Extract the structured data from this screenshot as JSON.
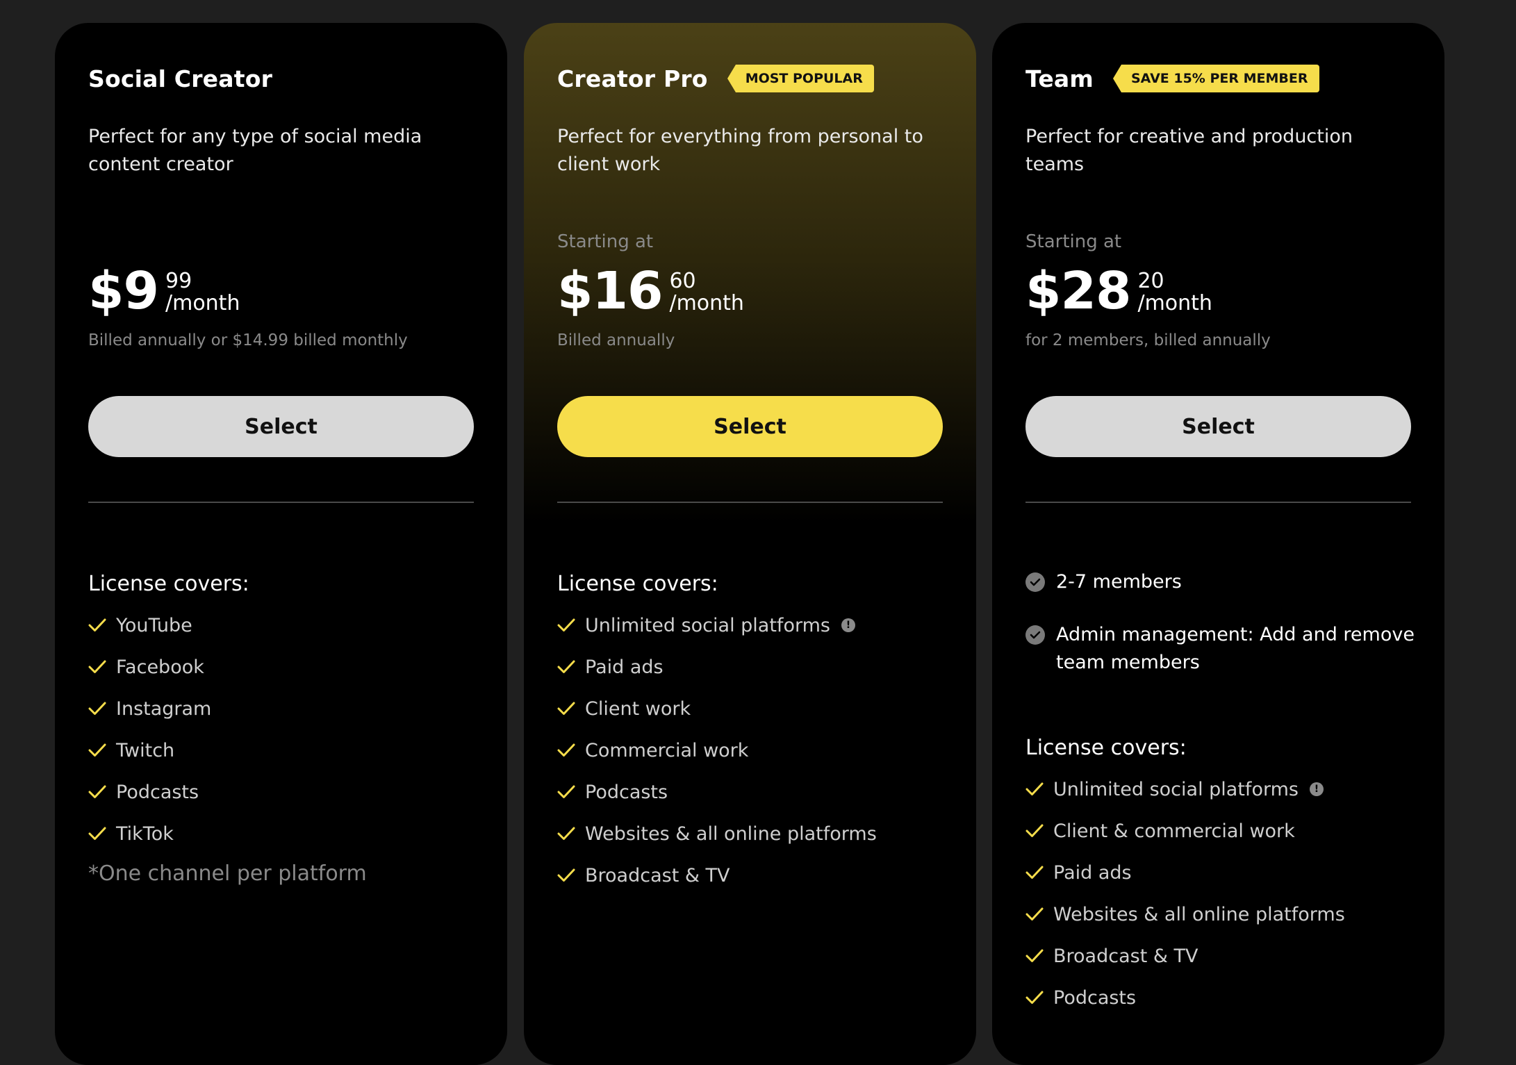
{
  "colors": {
    "accent": "#f6dd4b",
    "background": "#1f1f1f",
    "card": "#000000",
    "button_light": "#d8d8d8"
  },
  "plans": [
    {
      "title": "Social Creator",
      "badge": "",
      "subtitle": "Perfect for any type of social media content creator",
      "starting_label": "",
      "price_whole": "$9",
      "price_cents": "99",
      "price_period": "/month",
      "billing_note": "Billed annually or $14.99 billed monthly",
      "button_label": "Select",
      "license_title": "License covers:",
      "features": [
        "YouTube",
        "Facebook",
        "Instagram",
        "Twitch",
        "Podcasts",
        "TikTok"
      ],
      "footnote": "*One channel per platform"
    },
    {
      "title": "Creator Pro",
      "badge": "MOST POPULAR",
      "subtitle": "Perfect for everything from personal to client work",
      "starting_label": "Starting at",
      "price_whole": "$16",
      "price_cents": "60",
      "price_period": "/month",
      "billing_note": "Billed annually",
      "button_label": "Select",
      "license_title": "License covers:",
      "features": [
        "Unlimited social platforms",
        "Paid ads",
        "Client work",
        "Commercial work",
        "Podcasts",
        "Websites & all online platforms",
        "Broadcast & TV"
      ],
      "info_icon": "!"
    },
    {
      "title": "Team",
      "badge": "SAVE 15% PER MEMBER",
      "subtitle": "Perfect for creative and production teams",
      "starting_label": "Starting at",
      "price_whole": "$28",
      "price_cents": "20",
      "price_period": "/month",
      "billing_note": "for 2 members, billed annually",
      "button_label": "Select",
      "member_features": [
        "2-7 members",
        "Admin management: Add and remove team members"
      ],
      "license_title": "License covers:",
      "features": [
        "Unlimited social platforms",
        "Client & commercial work",
        "Paid ads",
        "Websites & all online platforms",
        "Broadcast & TV",
        "Podcasts"
      ],
      "info_icon": "!"
    }
  ]
}
